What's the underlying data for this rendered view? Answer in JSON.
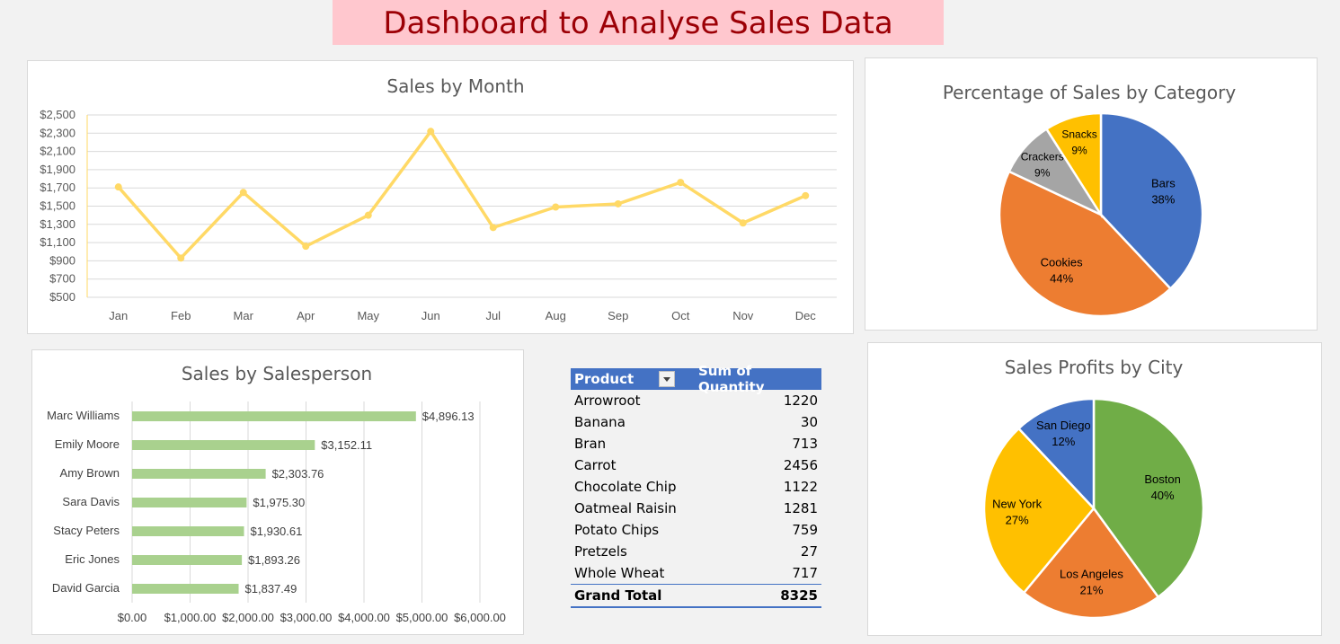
{
  "dashboard": {
    "title": "Dashboard to Analyse Sales Data"
  },
  "chart_data": [
    {
      "type": "line",
      "title": "Sales by Month",
      "categories": [
        "Jan",
        "Feb",
        "Mar",
        "Apr",
        "May",
        "Jun",
        "Jul",
        "Aug",
        "Sep",
        "Oct",
        "Nov",
        "Dec"
      ],
      "values": [
        1710,
        930,
        1650,
        1060,
        1400,
        2320,
        1265,
        1490,
        1525,
        1760,
        1315,
        1615
      ],
      "ylim": [
        500,
        2500
      ],
      "yticks": [
        "$500",
        "$700",
        "$900",
        "$1,100",
        "$1,300",
        "$1,500",
        "$1,700",
        "$1,900",
        "$2,100",
        "$2,300",
        "$2,500"
      ],
      "grid": true,
      "color": "#ffd966"
    },
    {
      "type": "bar",
      "orientation": "horizontal",
      "title": "Sales by Salesperson",
      "categories": [
        "Marc Williams",
        "Emily Moore",
        "Amy Brown",
        "Sara Davis",
        "Stacy Peters",
        "Eric Jones",
        "David Garcia"
      ],
      "values": [
        4896.13,
        3152.11,
        2303.76,
        1975.3,
        1930.61,
        1893.26,
        1837.49
      ],
      "data_labels": [
        "$4,896.13",
        "$3,152.11",
        "$2,303.76",
        "$1,975.30",
        "$1,930.61",
        "$1,893.26",
        "$1,837.49"
      ],
      "xlim": [
        0,
        6000
      ],
      "xticks": [
        "$0.00",
        "$1,000.00",
        "$2,000.00",
        "$3,000.00",
        "$4,000.00",
        "$5,000.00",
        "$6,000.00"
      ],
      "grid": true,
      "color": "#a9d18e"
    },
    {
      "type": "pie",
      "title": "Percentage of Sales by Category",
      "slices": [
        {
          "label": "Bars",
          "percent": 38,
          "text": "38%",
          "color": "#4472c4"
        },
        {
          "label": "Cookies",
          "percent": 44,
          "text": "44%",
          "color": "#ed7d31"
        },
        {
          "label": "Crackers",
          "percent": 9,
          "text": "9%",
          "color": "#a5a5a5"
        },
        {
          "label": "Snacks",
          "percent": 9,
          "text": "9%",
          "color": "#ffc000"
        }
      ]
    },
    {
      "type": "pie",
      "title": "Sales Profits by City",
      "slices": [
        {
          "label": "Boston",
          "percent": 40,
          "text": "40%",
          "color": "#70ad47"
        },
        {
          "label": "Los Angeles",
          "percent": 21,
          "text": "21%",
          "color": "#ed7d31"
        },
        {
          "label": "New York",
          "percent": 27,
          "text": "27%",
          "color": "#ffc000"
        },
        {
          "label": "San Diego",
          "percent": 12,
          "text": "12%",
          "color": "#4472c4"
        }
      ]
    },
    {
      "type": "table",
      "columns": [
        "Product",
        "Sum of Quantity"
      ],
      "rows": [
        {
          "product": "Arrowroot",
          "quantity": "1220"
        },
        {
          "product": "Banana",
          "quantity": "30"
        },
        {
          "product": "Bran",
          "quantity": "713"
        },
        {
          "product": "Carrot",
          "quantity": "2456"
        },
        {
          "product": "Chocolate Chip",
          "quantity": "1122"
        },
        {
          "product": "Oatmeal Raisin",
          "quantity": "1281"
        },
        {
          "product": "Potato Chips",
          "quantity": "759"
        },
        {
          "product": "Pretzels",
          "quantity": "27"
        },
        {
          "product": "Whole Wheat",
          "quantity": "717"
        }
      ],
      "total": {
        "label": "Grand Total",
        "value": "8325"
      }
    }
  ]
}
